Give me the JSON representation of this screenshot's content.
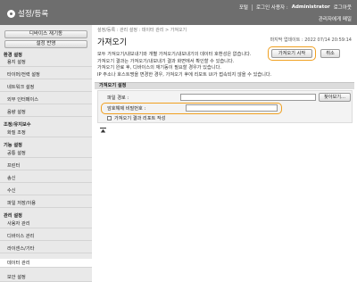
{
  "header": {
    "title": "설정/등록",
    "links": {
      "portal": "포털",
      "login_user_label": "로그인 사용자 :",
      "user": "Administrator",
      "logout": "로그아웃"
    },
    "contact": "관리자에게 메일"
  },
  "sidebar": {
    "restart_button": "디바이스 재기동",
    "apply_button": "설정 반영",
    "sections": [
      {
        "title": "환경 설정",
        "items": [
          "용지 설정",
          "타이머/전력 설정",
          "네트워크 설정",
          "외부 인터페이스",
          "음량 설정"
        ]
      },
      {
        "title": "조정/유지보수",
        "items": [
          "화질 조정"
        ]
      },
      {
        "title": "기능 설정",
        "items": [
          "공통 설정",
          "프린터",
          "송신",
          "수신",
          "파일 저장/이용"
        ]
      },
      {
        "title": "관리 설정",
        "items": [
          "사용자 관리",
          "디바이스 관리",
          "라이센스/기타",
          "데이터 관리",
          "보안 설정"
        ]
      }
    ]
  },
  "main": {
    "breadcrumb": "설정/등록 : 관리 설정 : 데이터 관리 > 가져오기",
    "title": "가져오기",
    "last_updated": "마지막 업데이트 : 2022 07/14 20:59:14",
    "start_button": "가져오기 시작",
    "cancel_button": "취소",
    "description": [
      "모두 가져오기/내보내기와 개별 가져오기/내보내기의 데이터 호환성은 없습니다.",
      "가져오기 결과는 가져오기/내보내기 결과 화면에서 확인할 수 있습니다.",
      "가져오기 완료 후, 디바이스의 재기동이 필요할 경우가 있습니다.",
      "IP 주소나 호스트명을 변경한 경우, 가져오기 후에 리모트 UI가 접속되지 않을 수 있습니다."
    ],
    "settings_header": "가져오기 설정",
    "file_path_label": "파일 경로 :",
    "file_path_value": "",
    "browse_button": "찾아보기...",
    "password_label": "암호해제 비밀번호 :",
    "password_value": "",
    "report_checkbox_label": "가져오기 결과 리포트 작성",
    "report_checked": false,
    "highlight_color": "#f0a020"
  }
}
